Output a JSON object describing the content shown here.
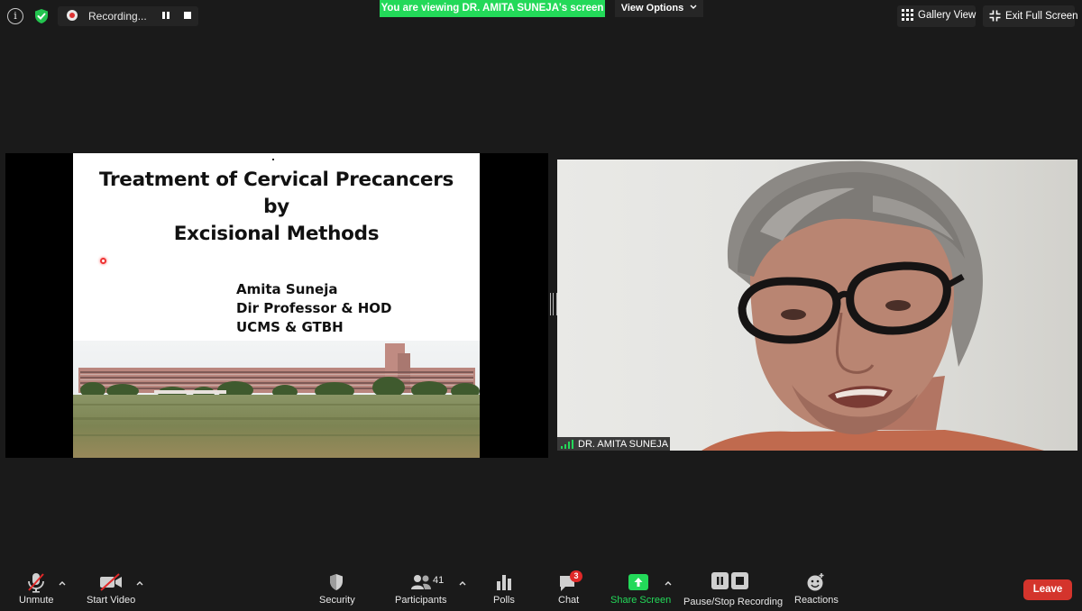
{
  "top_bar": {
    "info_glyph": "i",
    "recording_label": "Recording...",
    "viewing_banner": "You are viewing  DR. AMITA SUNEJA's screen",
    "view_options_label": "View Options",
    "gallery_view_label": "Gallery View",
    "exit_fullscreen_label": "Exit Full Screen"
  },
  "shared_slide": {
    "title_lines": [
      "Treatment of Cervical Precancers",
      "by",
      "Excisional Methods"
    ],
    "author_lines": [
      "Amita Suneja",
      "Dir Professor & HOD",
      "UCMS & GTBH"
    ]
  },
  "video": {
    "participant_name": "DR. AMITA SUNEJA"
  },
  "toolbar": {
    "unmute_label": "Unmute",
    "start_video_label": "Start Video",
    "security_label": "Security",
    "participants_label": "Participants",
    "participants_count": "41",
    "polls_label": "Polls",
    "chat_label": "Chat",
    "chat_badge": "3",
    "share_screen_label": "Share Screen",
    "recording_label": "Pause/Stop Recording",
    "reactions_label": "Reactions",
    "leave_label": "Leave"
  },
  "colors": {
    "background": "#1a1a1a",
    "green_accent": "#23d959",
    "leave_red": "#d4342c",
    "badge_red": "#e02828"
  },
  "icons": [
    "info-icon",
    "shield-check-icon",
    "recording-dot-icon",
    "pause-icon",
    "stop-icon",
    "gallery-grid-icon",
    "exit-fullscreen-icon",
    "signal-bars-icon",
    "microphone-muted-icon",
    "video-off-icon",
    "security-shield-icon",
    "participants-icon",
    "polls-icon",
    "chat-icon",
    "share-screen-icon",
    "pause-stop-recording-icon",
    "reactions-icon"
  ]
}
